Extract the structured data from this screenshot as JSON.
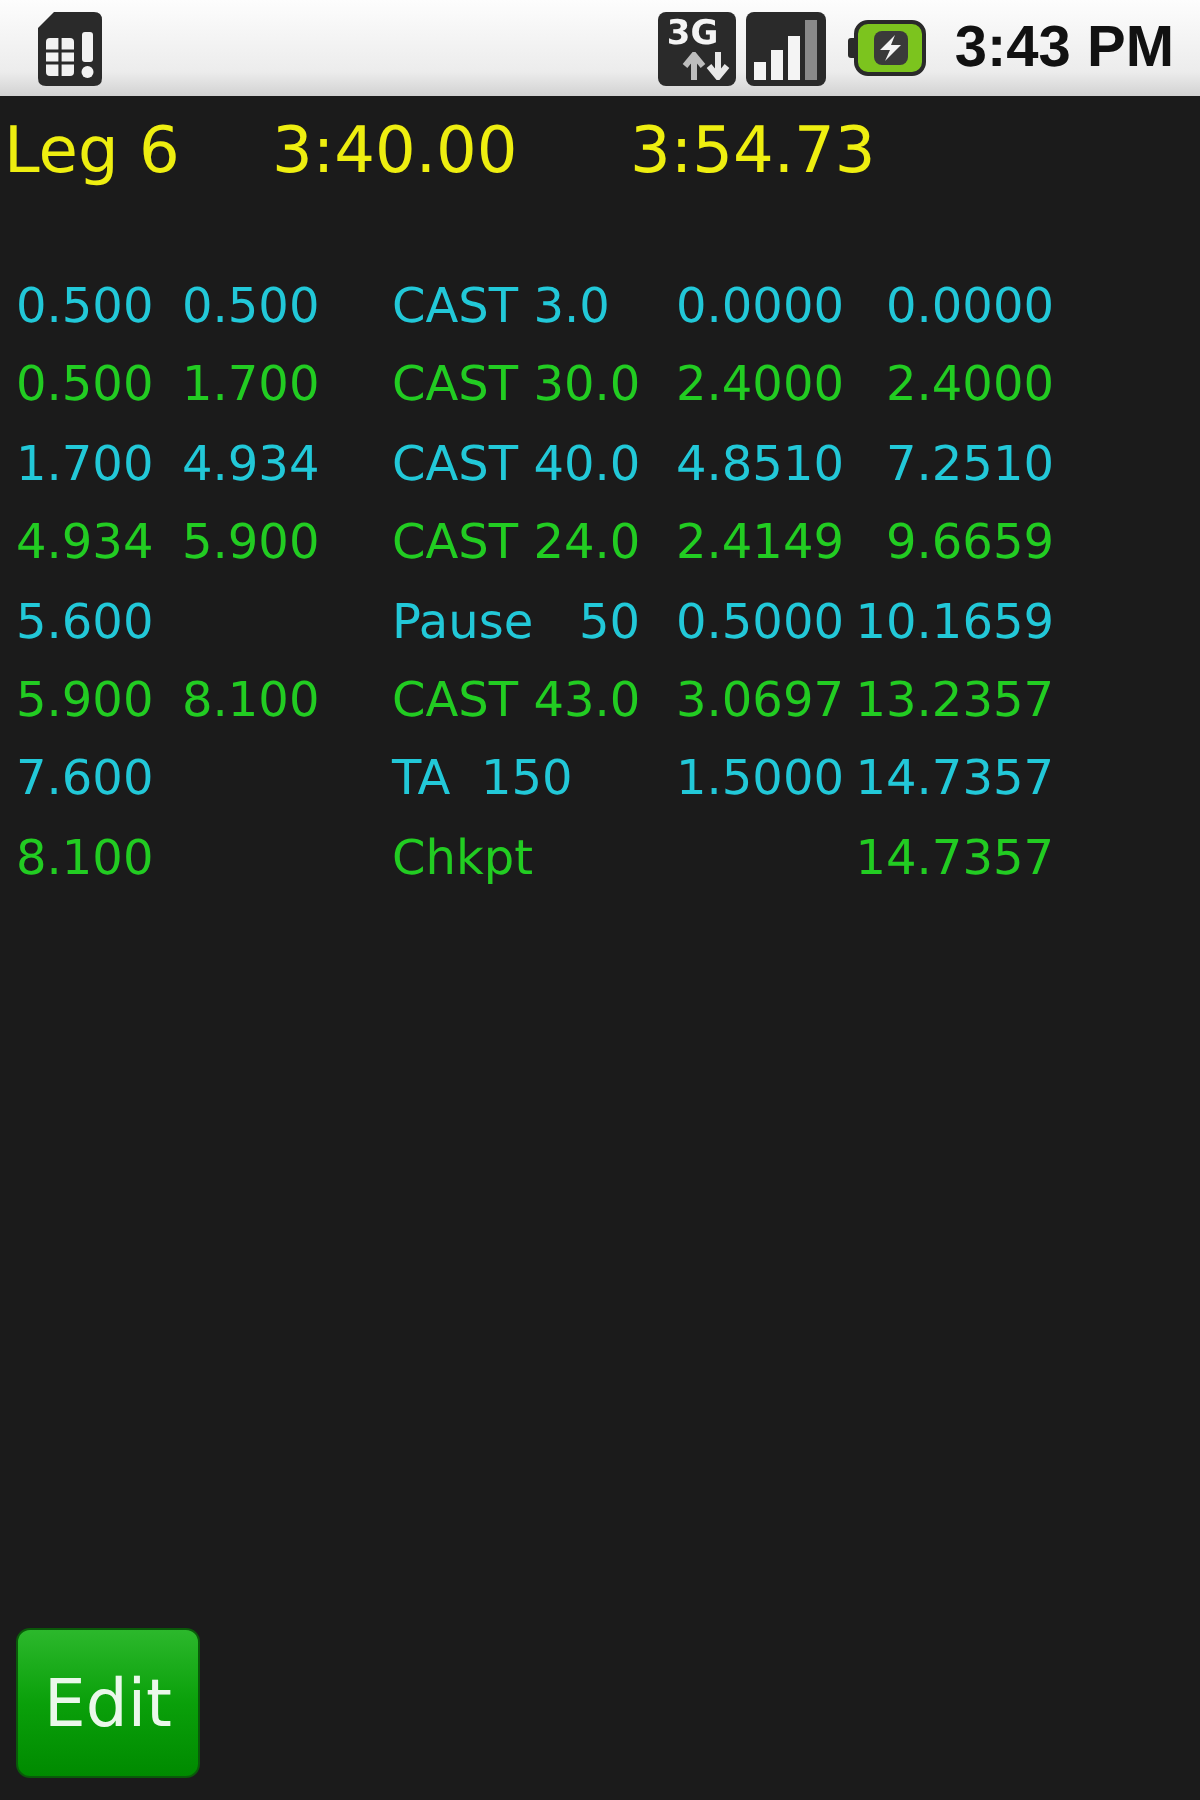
{
  "status_bar": {
    "network_type": "3G",
    "time": "3:43 PM"
  },
  "header": {
    "title": "Leg 6",
    "times": [
      "3:40.00",
      "3:54.73"
    ]
  },
  "rows": [
    {
      "color": "#22c8d8",
      "column_1": "0.500",
      "column_2": "0.500",
      "column_3": "CAST 3.0",
      "column_4": "0.0000",
      "column_5": "0.0000"
    },
    {
      "color": "#22cc22",
      "column_1": "0.500",
      "column_2": "1.700",
      "column_3": "CAST 30.0",
      "column_4": "2.4000",
      "column_5": "2.4000"
    },
    {
      "color": "#22c8d8",
      "column_1": "1.700",
      "column_2": "4.934",
      "column_3": "CAST 40.0",
      "column_4": "4.8510",
      "column_5": "7.2510"
    },
    {
      "color": "#22cc22",
      "column_1": "4.934",
      "column_2": "5.900",
      "column_3": "CAST 24.0",
      "column_4": "2.4149",
      "column_5": "9.6659"
    },
    {
      "color": "#22c8d8",
      "column_1": "5.600",
      "column_3": "Pause   50",
      "column_4": "0.5000",
      "column_5": "10.1659"
    },
    {
      "color": "#22cc22",
      "column_1": "5.900",
      "column_2": "8.100",
      "column_3": "CAST 43.0",
      "column_4": "3.0697",
      "column_5": "13.2357"
    },
    {
      "color": "#22c8d8",
      "column_1": "7.600",
      "column_3": "TA  150",
      "column_4": "1.5000",
      "column_5": "14.7357"
    },
    {
      "color": "#22cc22",
      "column_1": "8.100",
      "column_3": "Chkpt",
      "column_5": "14.7357"
    }
  ],
  "buttons": [
    {
      "label": "Edit"
    }
  ]
}
